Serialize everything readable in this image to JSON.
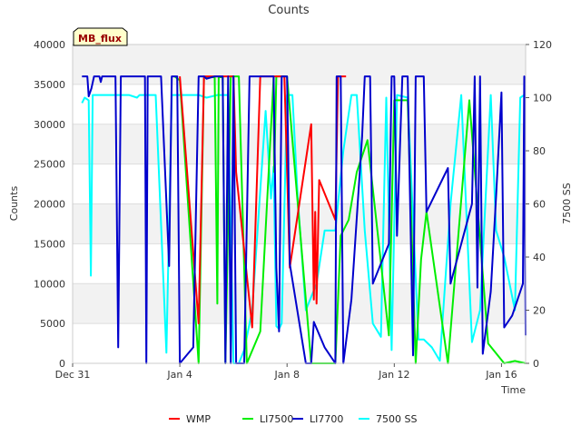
{
  "chart_data": {
    "type": "line",
    "title": "Counts",
    "xlabel": "Time",
    "ylabel": "Counts",
    "y2label": "7500 SS",
    "badge": "MB_flux",
    "x_ticks": [
      "Dec 31",
      "Jan 4",
      "Jan 8",
      "Jan 12",
      "Jan 16"
    ],
    "x_tick_days": [
      0,
      4,
      8,
      12,
      16
    ],
    "xlim": [
      0,
      16.9
    ],
    "ylim": [
      0,
      40000
    ],
    "y_ticks": [
      0,
      5000,
      10000,
      15000,
      20000,
      25000,
      30000,
      35000,
      40000
    ],
    "y2lim": [
      0,
      120
    ],
    "y2_ticks": [
      0,
      20,
      40,
      60,
      80,
      100,
      120
    ],
    "grid": "horizontal bands",
    "legend_position": "bottom",
    "colors": {
      "WMP": "#ff0000",
      "LI7500": "#00ee00",
      "LI7700": "#0000cc",
      "7500 SS": "#00ffff"
    },
    "series": [
      {
        "name": "7500 SS",
        "axis": "right",
        "color": "#00ffff",
        "points": [
          [
            0.35,
            98
          ],
          [
            0.45,
            100
          ],
          [
            0.6,
            99
          ],
          [
            0.68,
            33
          ],
          [
            0.75,
            101
          ],
          [
            1.2,
            101
          ],
          [
            1.5,
            101
          ],
          [
            2.1,
            101
          ],
          [
            2.4,
            100
          ],
          [
            2.5,
            101
          ],
          [
            3.1,
            101
          ],
          [
            3.5,
            4
          ],
          [
            3.7,
            101
          ],
          [
            4.0,
            101
          ],
          [
            4.7,
            101
          ],
          [
            5.0,
            100
          ],
          [
            5.4,
            101
          ],
          [
            5.8,
            101
          ],
          [
            6.0,
            0
          ],
          [
            6.2,
            0
          ],
          [
            6.4,
            5
          ],
          [
            6.7,
            20
          ],
          [
            7.2,
            95
          ],
          [
            7.4,
            62
          ],
          [
            7.5,
            74
          ],
          [
            7.6,
            14
          ],
          [
            7.7,
            13
          ],
          [
            7.8,
            15
          ],
          [
            8.0,
            101
          ],
          [
            8.2,
            101
          ],
          [
            8.4,
            62
          ],
          [
            8.7,
            20
          ],
          [
            9.1,
            30
          ],
          [
            9.4,
            50
          ],
          [
            9.8,
            50
          ],
          [
            10.1,
            80
          ],
          [
            10.4,
            101
          ],
          [
            10.6,
            101
          ],
          [
            10.9,
            50
          ],
          [
            11.2,
            15
          ],
          [
            11.5,
            10
          ],
          [
            11.7,
            100
          ],
          [
            11.9,
            5
          ],
          [
            12.1,
            101
          ],
          [
            12.5,
            100
          ],
          [
            12.9,
            9
          ],
          [
            13.1,
            9
          ],
          [
            13.4,
            6
          ],
          [
            13.7,
            1
          ],
          [
            14.1,
            60
          ],
          [
            14.5,
            101
          ],
          [
            14.9,
            8
          ],
          [
            15.2,
            20
          ],
          [
            15.6,
            101
          ],
          [
            15.8,
            50
          ],
          [
            16.1,
            40
          ],
          [
            16.5,
            20
          ],
          [
            16.7,
            100
          ],
          [
            16.85,
            101
          ]
        ]
      },
      {
        "name": "LI7500",
        "axis": "left",
        "color": "#00ee00",
        "points": [
          [
            3.8,
            36000
          ],
          [
            4.0,
            35500
          ],
          [
            4.7,
            0
          ],
          [
            4.9,
            35900
          ],
          [
            5.3,
            35900
          ],
          [
            5.4,
            7500
          ],
          [
            5.45,
            35900
          ],
          [
            5.6,
            35900
          ],
          [
            5.7,
            0
          ],
          [
            5.9,
            36000
          ],
          [
            6.2,
            36000
          ],
          [
            6.5,
            0
          ],
          [
            7.0,
            4000
          ],
          [
            7.5,
            35800
          ],
          [
            7.52,
            24000
          ],
          [
            7.6,
            36000
          ],
          [
            8.0,
            36000
          ],
          [
            8.9,
            0
          ],
          [
            9.8,
            0
          ],
          [
            10.0,
            16000
          ],
          [
            10.3,
            18000
          ],
          [
            10.6,
            24000
          ],
          [
            11.0,
            28000
          ],
          [
            11.8,
            3500
          ],
          [
            12.0,
            33000
          ],
          [
            12.5,
            33000
          ],
          [
            12.8,
            0
          ],
          [
            13.0,
            13000
          ],
          [
            13.2,
            19000
          ],
          [
            14.0,
            0
          ],
          [
            14.8,
            33000
          ],
          [
            15.5,
            2500
          ],
          [
            16.1,
            0
          ],
          [
            16.5,
            300
          ],
          [
            16.9,
            0
          ]
        ]
      },
      {
        "name": "WMP",
        "axis": "left",
        "color": "#ff0000",
        "points": [
          [
            4.0,
            36000
          ],
          [
            4.7,
            5000
          ],
          [
            4.9,
            36000
          ],
          [
            5.6,
            36000
          ],
          [
            6.0,
            36000
          ],
          [
            6.1,
            24000
          ],
          [
            6.7,
            4500
          ],
          [
            7.0,
            36000
          ],
          [
            7.9,
            36000
          ],
          [
            8.1,
            12000
          ],
          [
            8.9,
            30000
          ],
          [
            9.0,
            8000
          ],
          [
            9.05,
            19000
          ],
          [
            9.1,
            7500
          ],
          [
            9.2,
            23000
          ],
          [
            9.8,
            18000
          ],
          [
            9.9,
            36000
          ],
          [
            10.2,
            36000
          ]
        ]
      },
      {
        "name": "LI7700",
        "axis": "left",
        "color": "#0000cc",
        "points": [
          [
            0.35,
            36000
          ],
          [
            0.55,
            36000
          ],
          [
            0.6,
            33500
          ],
          [
            0.7,
            34500
          ],
          [
            0.8,
            36000
          ],
          [
            1.0,
            36000
          ],
          [
            1.05,
            35300
          ],
          [
            1.1,
            36000
          ],
          [
            1.6,
            36000
          ],
          [
            1.7,
            2000
          ],
          [
            1.8,
            36000
          ],
          [
            2.5,
            36000
          ],
          [
            2.7,
            36000
          ],
          [
            2.75,
            0
          ],
          [
            2.8,
            36000
          ],
          [
            3.3,
            36000
          ],
          [
            3.6,
            12200
          ],
          [
            3.7,
            36000
          ],
          [
            3.9,
            36000
          ],
          [
            4.0,
            0
          ],
          [
            4.5,
            2000
          ],
          [
            4.7,
            36000
          ],
          [
            4.9,
            36000
          ],
          [
            5.0,
            35700
          ],
          [
            5.3,
            36000
          ],
          [
            5.6,
            36000
          ],
          [
            5.7,
            0
          ],
          [
            5.8,
            36000
          ],
          [
            5.9,
            0
          ],
          [
            6.0,
            36000
          ],
          [
            6.1,
            0
          ],
          [
            6.4,
            0
          ],
          [
            6.6,
            36000
          ],
          [
            7.2,
            36000
          ],
          [
            7.5,
            36000
          ],
          [
            7.6,
            12000
          ],
          [
            7.7,
            4000
          ],
          [
            7.8,
            36000
          ],
          [
            8.0,
            36000
          ],
          [
            8.1,
            12500
          ],
          [
            8.7,
            0
          ],
          [
            8.9,
            0
          ],
          [
            9.0,
            5200
          ],
          [
            9.4,
            2000
          ],
          [
            9.8,
            0
          ],
          [
            9.85,
            36000
          ],
          [
            10.0,
            36000
          ],
          [
            10.1,
            0
          ],
          [
            10.4,
            8000
          ],
          [
            10.8,
            28500
          ],
          [
            10.9,
            36000
          ],
          [
            11.1,
            36000
          ],
          [
            11.2,
            10000
          ],
          [
            11.8,
            15000
          ],
          [
            11.9,
            36000
          ],
          [
            12.0,
            36000
          ],
          [
            12.1,
            16000
          ],
          [
            12.3,
            36000
          ],
          [
            12.5,
            36000
          ],
          [
            12.7,
            1000
          ],
          [
            12.8,
            36000
          ],
          [
            13.1,
            36000
          ],
          [
            13.2,
            19000
          ],
          [
            14.0,
            24500
          ],
          [
            14.1,
            10000
          ],
          [
            14.9,
            20000
          ],
          [
            15.0,
            36000
          ],
          [
            15.1,
            9500
          ],
          [
            15.2,
            36000
          ],
          [
            15.3,
            1200
          ],
          [
            15.6,
            9000
          ],
          [
            15.8,
            21000
          ],
          [
            16.0,
            34000
          ],
          [
            16.1,
            4500
          ],
          [
            16.4,
            6000
          ],
          [
            16.8,
            10000
          ],
          [
            16.85,
            36000
          ],
          [
            16.9,
            3500
          ]
        ]
      }
    ]
  }
}
